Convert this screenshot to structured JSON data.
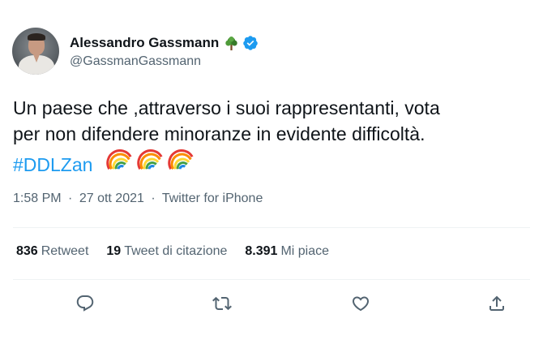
{
  "author": {
    "display_name": "Alessandro Gassmann",
    "handle": "@GassmanGassmann",
    "badge_icons": [
      "tree-icon",
      "verified-icon"
    ],
    "verified_color": "#1d9bf0"
  },
  "tweet": {
    "text_lines": [
      "Un paese che ,attraverso i suoi rappresentanti, vota",
      "per non difendere minoranze in evidente difficoltà."
    ],
    "hashtag": "#DDLZan",
    "emoji": [
      "rainbow",
      "rainbow",
      "rainbow"
    ]
  },
  "meta": {
    "time": "1:58 PM",
    "separator": "·",
    "date": "27 ott 2021",
    "source": "Twitter for iPhone"
  },
  "stats": [
    {
      "count": "836",
      "label": "Retweet"
    },
    {
      "count": "19",
      "label": "Tweet di citazione"
    },
    {
      "count": "8.391",
      "label": "Mi piace"
    }
  ],
  "actions": [
    "reply-icon",
    "retweet-icon",
    "like-icon",
    "share-icon"
  ],
  "colors": {
    "text": "#0f1419",
    "secondary": "#536471",
    "link": "#1d9bf0",
    "divider": "#eff3f4"
  }
}
